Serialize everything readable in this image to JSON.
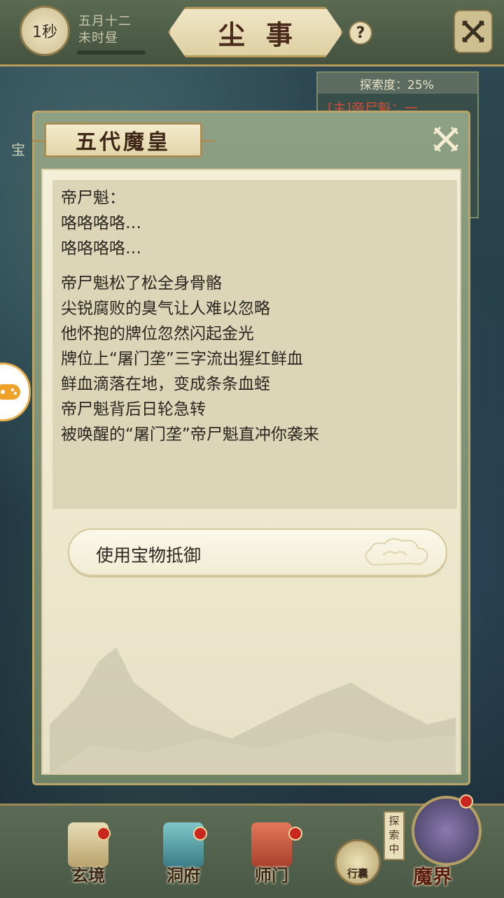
{
  "topbar": {
    "timer": "1秒",
    "date_line1": "五月十二",
    "date_line2": "未时昼",
    "title": "尘事",
    "help": "?"
  },
  "explore_panel": {
    "progress": "探索度：25%",
    "line": "[主]帝尸魁：一",
    "side_label": "宝"
  },
  "modal": {
    "title": "五代魔皇",
    "lines_group1": [
      "帝尸魁：",
      "咯咯咯咯…",
      "咯咯咯咯…"
    ],
    "lines_group2": [
      "帝尸魁松了松全身骨骼",
      "尖锐腐败的臭气让人难以忽略",
      "他怀抱的牌位忽然闪起金光",
      "牌位上“屠门垄”三字流出猩红鲜血",
      "鲜血滴落在地，变成条条血蛭",
      "帝尸魁背后日轮急转",
      "被唤醒的“屠门垄”帝尸魁直冲你袭来"
    ],
    "option": "使用宝物抵御"
  },
  "bottom_nav": {
    "items": [
      {
        "label": "玄境"
      },
      {
        "label": "洞府"
      },
      {
        "label": "师门"
      }
    ],
    "bag_label": "行囊",
    "exploring_label": "探索中",
    "mojie_label": "魔界"
  },
  "colors": {
    "panel_green": "#6f8466",
    "paper": "#f4efd9",
    "gold_border": "#b9a568",
    "badge_red": "#c9261e"
  }
}
